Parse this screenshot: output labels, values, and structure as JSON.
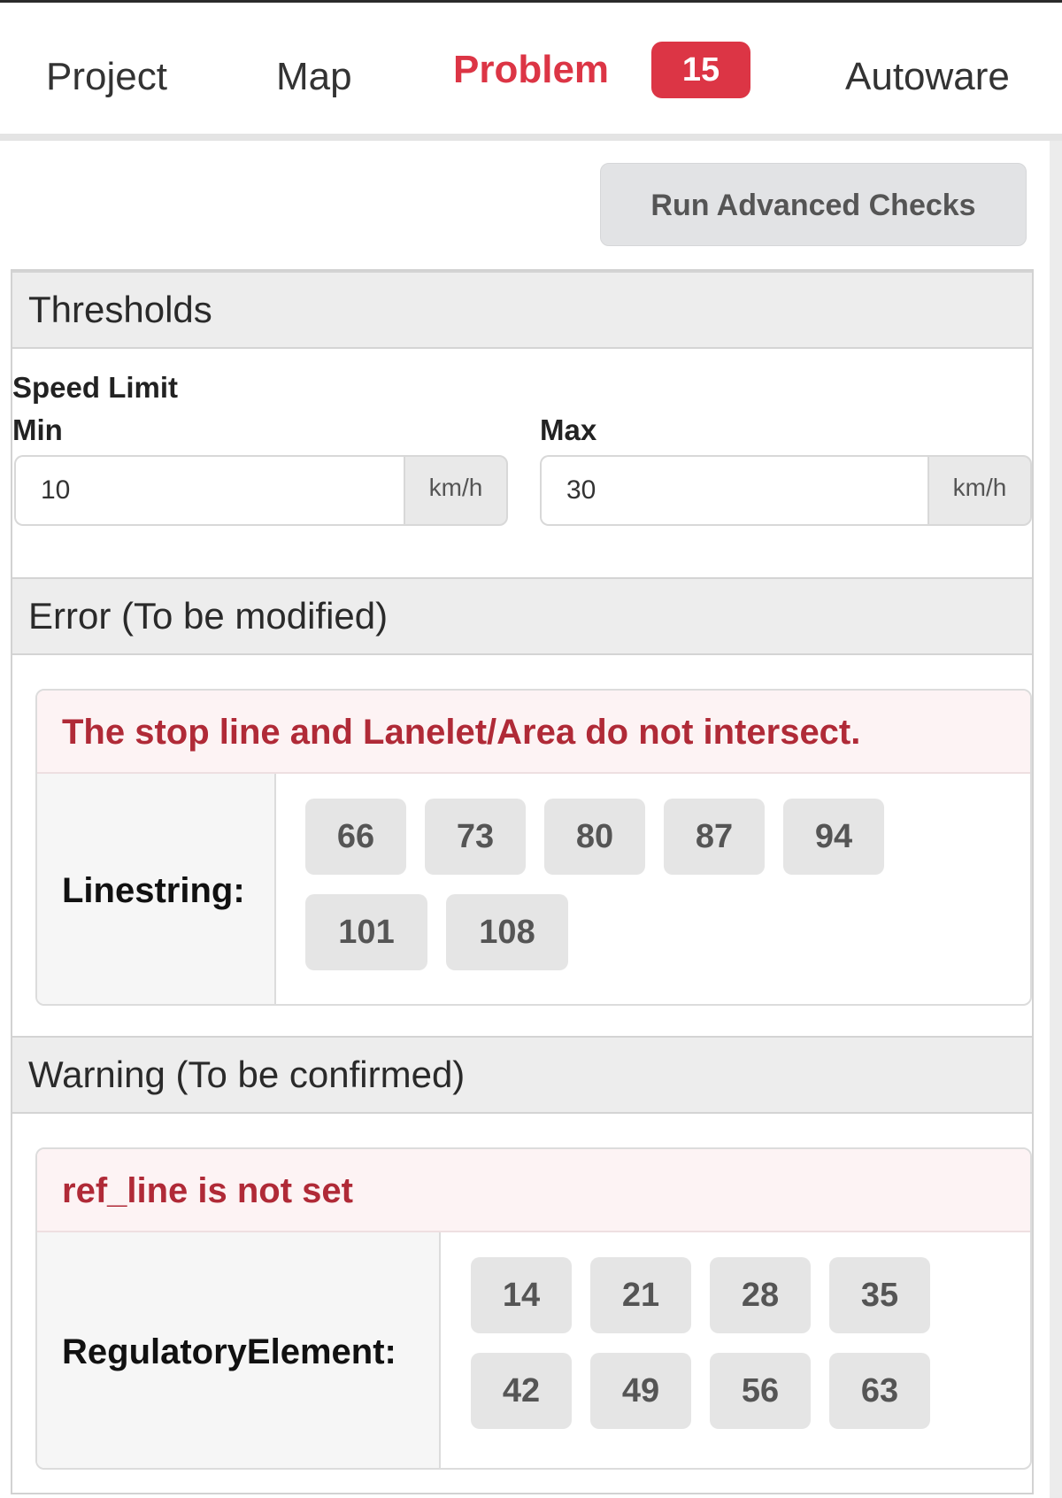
{
  "tabs": [
    {
      "label": "Project"
    },
    {
      "label": "Map"
    },
    {
      "label": "Problem",
      "badge": "15"
    },
    {
      "label": "Autoware"
    }
  ],
  "actions": {
    "run_label": "Run Advanced Checks"
  },
  "thresholds": {
    "header": "Thresholds",
    "speed_limit_label": "Speed Limit",
    "min": {
      "label": "Min",
      "value": "10",
      "unit": "km/h"
    },
    "max": {
      "label": "Max",
      "value": "30",
      "unit": "km/h"
    }
  },
  "error_section": {
    "header": "Error (To be modified)",
    "message": "The stop line and Lanelet/Area do not intersect.",
    "label": "Linestring:",
    "ids": [
      "66",
      "73",
      "80",
      "87",
      "94",
      "101",
      "108"
    ]
  },
  "warning_section": {
    "header": "Warning (To be confirmed)",
    "message": "ref_line is not set",
    "label": "RegulatoryElement:",
    "ids": [
      "14",
      "21",
      "28",
      "35",
      "42",
      "49",
      "56",
      "63"
    ]
  },
  "colors": {
    "accent_red": "#dc3545",
    "error_text": "#b02a37",
    "message_bg": "#fdf3f4",
    "chip_bg": "#e5e5e5"
  }
}
